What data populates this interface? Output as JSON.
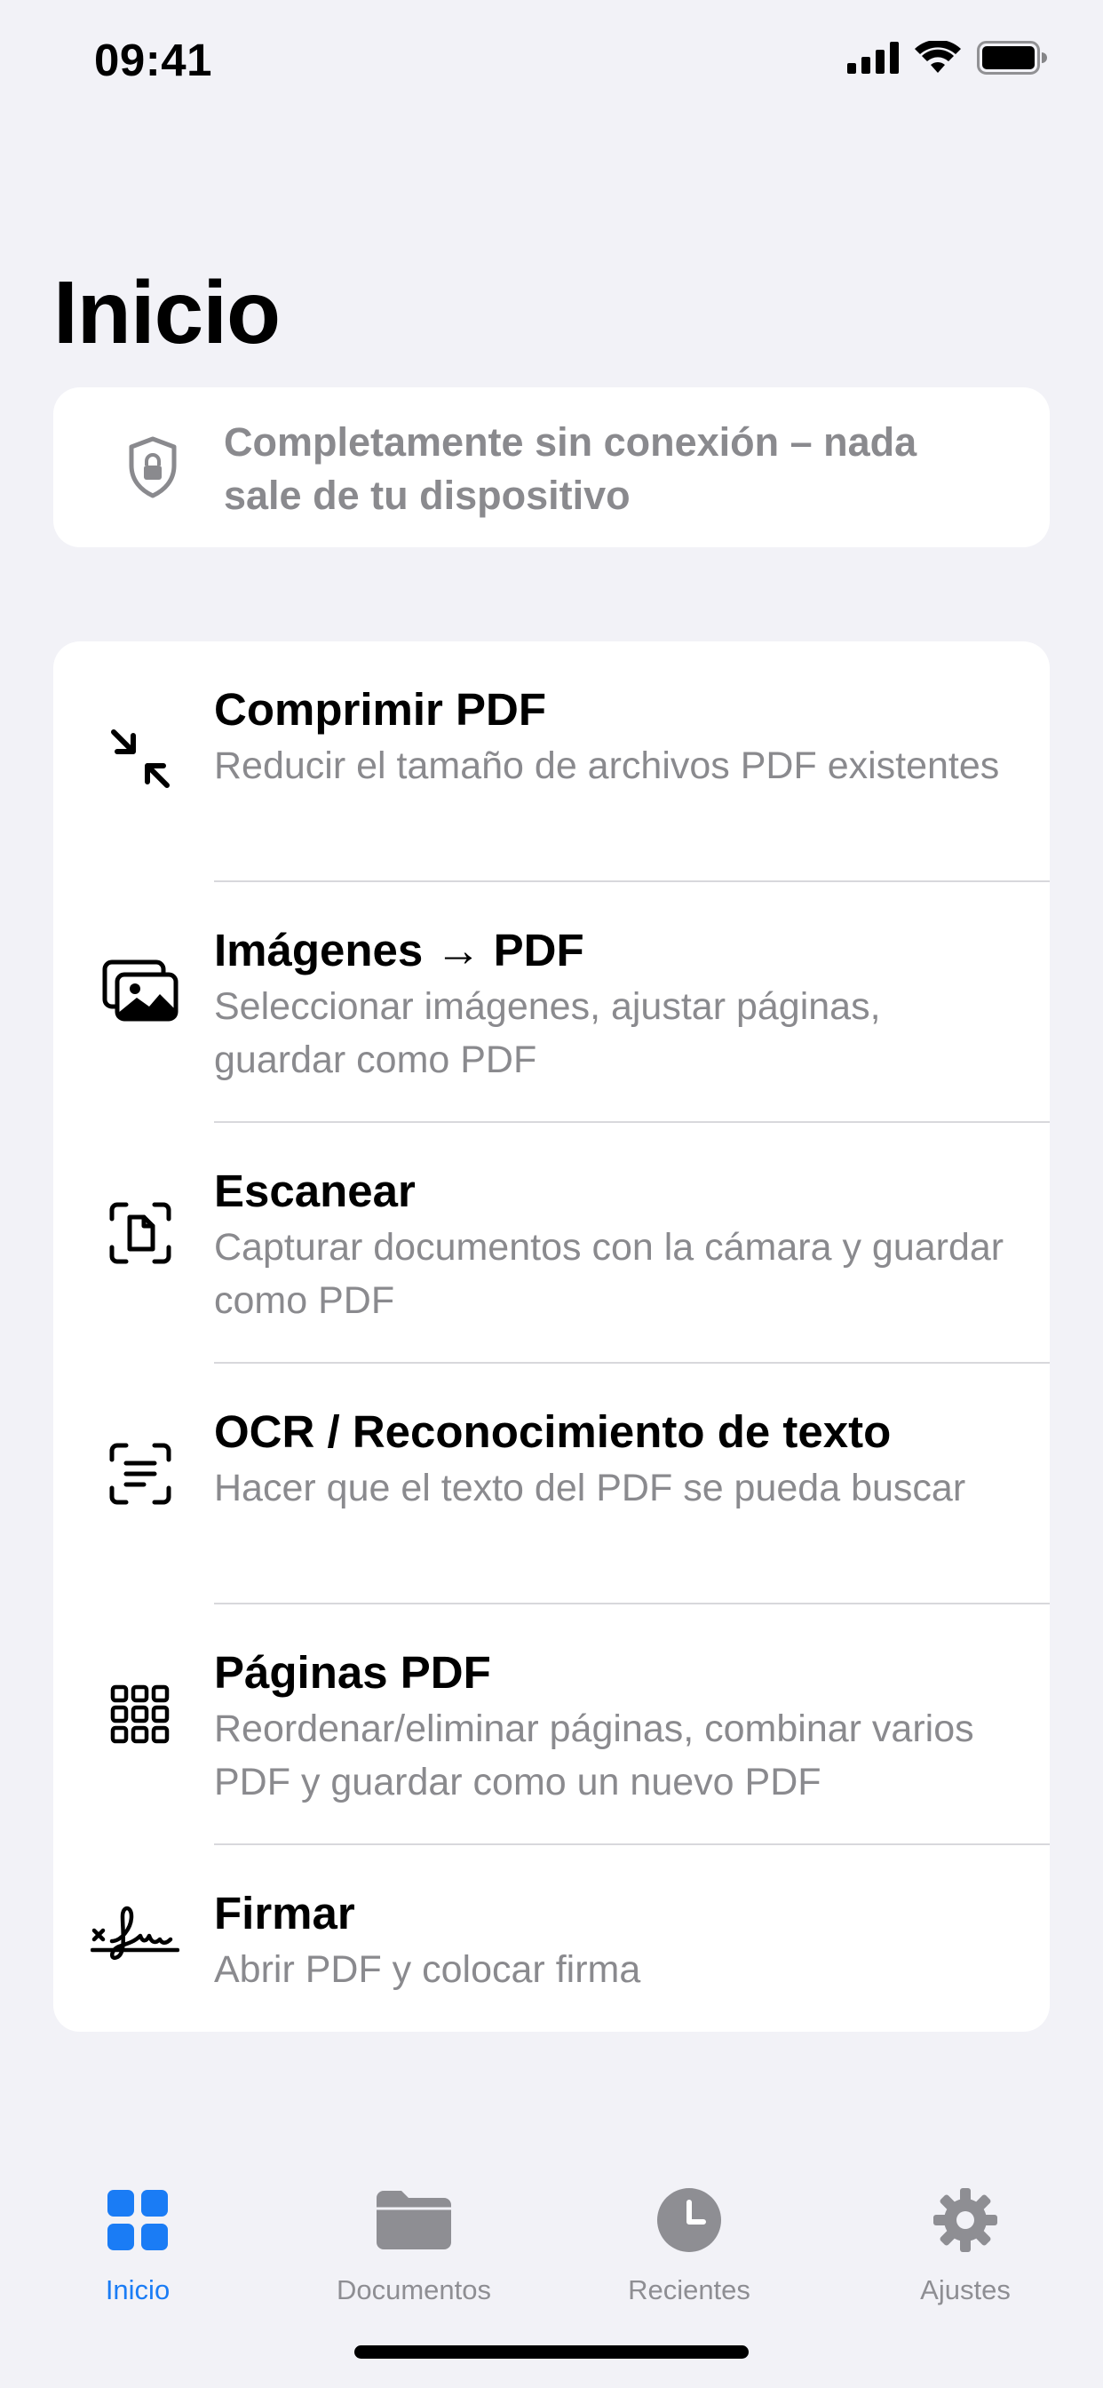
{
  "status_bar": {
    "time": "09:41",
    "icons": [
      "signal-icon",
      "wifi-icon",
      "battery-icon"
    ]
  },
  "page": {
    "title": "Inicio"
  },
  "banner": {
    "icon": "shield-lock-icon",
    "text": "Completamente sin conexión – nada sale de tu dispositivo"
  },
  "tools": [
    {
      "icon": "compress-arrows-icon",
      "title": "Comprimir PDF",
      "subtitle": "Reducir el tamaño de archivos PDF existentes"
    },
    {
      "icon": "images-icon",
      "title": "Imágenes → PDF",
      "subtitle": "Seleccionar imágenes, ajustar páginas, guardar como PDF"
    },
    {
      "icon": "scan-document-icon",
      "title": "Escanear",
      "subtitle": "Capturar documentos con la cámara y guardar como PDF"
    },
    {
      "icon": "text-recognition-icon",
      "title": "OCR / Reconocimiento de texto",
      "subtitle": "Hacer que el texto del PDF se pueda buscar"
    },
    {
      "icon": "page-grid-icon",
      "title": "Páginas PDF",
      "subtitle": "Reordenar/eliminar páginas, combinar varios PDF y guardar como un nuevo PDF"
    },
    {
      "icon": "signature-icon",
      "title": "Firmar",
      "subtitle": "Abrir PDF y colocar firma"
    }
  ],
  "tab_bar": {
    "tabs": [
      {
        "label": "Inicio",
        "icon": "grid-icon",
        "active": true
      },
      {
        "label": "Documentos",
        "icon": "folder-icon",
        "active": false
      },
      {
        "label": "Recientes",
        "icon": "clock-icon",
        "active": false
      },
      {
        "label": "Ajustes",
        "icon": "gear-icon",
        "active": false
      }
    ]
  },
  "colors": {
    "background": "#f2f2f7",
    "card": "#ffffff",
    "accent": "#1a7cf5",
    "secondary_text": "#8a8a8e",
    "inactive_tab": "#8e8e93"
  }
}
